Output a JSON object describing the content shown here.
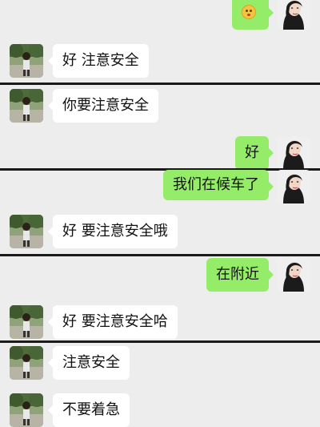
{
  "colors": {
    "background": "#ededed",
    "incoming_bubble": "#ffffff",
    "outgoing_bubble": "#95ec69",
    "divider": "#1a1a1a"
  },
  "messages": [
    {
      "side": "out",
      "text": "",
      "icon": "kiss-emoji-icon"
    },
    {
      "side": "in",
      "text": "好 注意安全"
    },
    {
      "side": "in",
      "text": "你要注意安全"
    },
    {
      "side": "out",
      "text": "好"
    },
    {
      "side": "out",
      "text": "我们在候车了"
    },
    {
      "side": "in",
      "text": "好 要注意安全哦"
    },
    {
      "side": "out",
      "text": "在附近"
    },
    {
      "side": "in",
      "text": "好 要注意安全哈"
    },
    {
      "side": "in",
      "text": "注意安全"
    },
    {
      "side": "in",
      "text": "不要着急"
    }
  ]
}
